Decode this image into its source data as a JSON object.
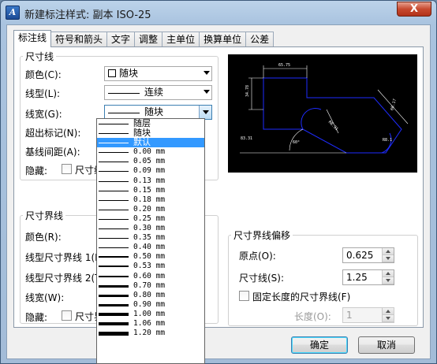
{
  "window": {
    "title": "新建标注样式: 副本 ISO-25",
    "close_label": "X"
  },
  "tabs": [
    "标注线",
    "符号和箭头",
    "文字",
    "调整",
    "主单位",
    "换算单位",
    "公差"
  ],
  "dim_line_group": {
    "title": "尺寸线",
    "color_label": "颜色(C):",
    "color_value": "随块",
    "linetype_label": "线型(L):",
    "linetype_value": "连续",
    "lineweight_label": "线宽(G):",
    "lineweight_value": "随块",
    "extend_label": "超出标记(N):",
    "baseline_label": "基线间距(A):",
    "suppress_label": "隐藏:",
    "suppress_dim1_label": "尺寸线"
  },
  "ext_line_group": {
    "title": "尺寸界线",
    "color_label": "颜色(R):",
    "linetype1_label": "线型尺寸界线 1(I",
    "linetype2_label": "线型尺寸界线 2(T",
    "lineweight_label": "线宽(W):",
    "suppress_label": "隐藏:",
    "suppress_ext1_label": "尺寸界线"
  },
  "offset_group": {
    "title": "尺寸界线偏移",
    "origin_label": "原点(O):",
    "origin_value": "0.625",
    "dimline_label": "尺寸线(S):",
    "dimline_value": "1.25",
    "fixed_length_label": "固定长度的尺寸界线(F)",
    "length_label": "长度(O):",
    "length_value": "1"
  },
  "preview": {
    "dim_top": "65.75",
    "dim_left": "34.78",
    "dim_right": "60.17",
    "dim_bottom": "83.31",
    "dim_mid": "R8.31",
    "dim_angle": "60°",
    "dim_r": "R8.1"
  },
  "lineweight_options": [
    {
      "label": "随层",
      "type": "cn",
      "weight": 1
    },
    {
      "label": "随块",
      "type": "cn",
      "weight": 1
    },
    {
      "label": "默认",
      "type": "cn",
      "weight": 1,
      "selected": true
    },
    {
      "label": "0.00 mm",
      "type": "mm",
      "weight": 1
    },
    {
      "label": "0.05 mm",
      "type": "mm",
      "weight": 1
    },
    {
      "label": "0.09 mm",
      "type": "mm",
      "weight": 1
    },
    {
      "label": "0.13 mm",
      "type": "mm",
      "weight": 1
    },
    {
      "label": "0.15 mm",
      "type": "mm",
      "weight": 1
    },
    {
      "label": "0.18 mm",
      "type": "mm",
      "weight": 1
    },
    {
      "label": "0.20 mm",
      "type": "mm",
      "weight": 1
    },
    {
      "label": "0.25 mm",
      "type": "mm",
      "weight": 1
    },
    {
      "label": "0.30 mm",
      "type": "mm",
      "weight": 1
    },
    {
      "label": "0.35 mm",
      "type": "mm",
      "weight": 1
    },
    {
      "label": "0.40 mm",
      "type": "mm",
      "weight": 1
    },
    {
      "label": "0.50 mm",
      "type": "mm",
      "weight": 2
    },
    {
      "label": "0.53 mm",
      "type": "mm",
      "weight": 2
    },
    {
      "label": "0.60 mm",
      "type": "mm",
      "weight": 2
    },
    {
      "label": "0.70 mm",
      "type": "mm",
      "weight": 3
    },
    {
      "label": "0.80 mm",
      "type": "mm",
      "weight": 3
    },
    {
      "label": "0.90 mm",
      "type": "mm",
      "weight": 3
    },
    {
      "label": "1.00 mm",
      "type": "mm",
      "weight": 4
    },
    {
      "label": "1.06 mm",
      "type": "mm",
      "weight": 4
    },
    {
      "label": "1.20 mm",
      "type": "mm",
      "weight": 5
    }
  ],
  "buttons": {
    "ok": "确定",
    "cancel": "取消"
  },
  "colors": {
    "selection": "#3399ff",
    "preview_bg": "#000000",
    "preview_blue": "#1e2cff"
  }
}
